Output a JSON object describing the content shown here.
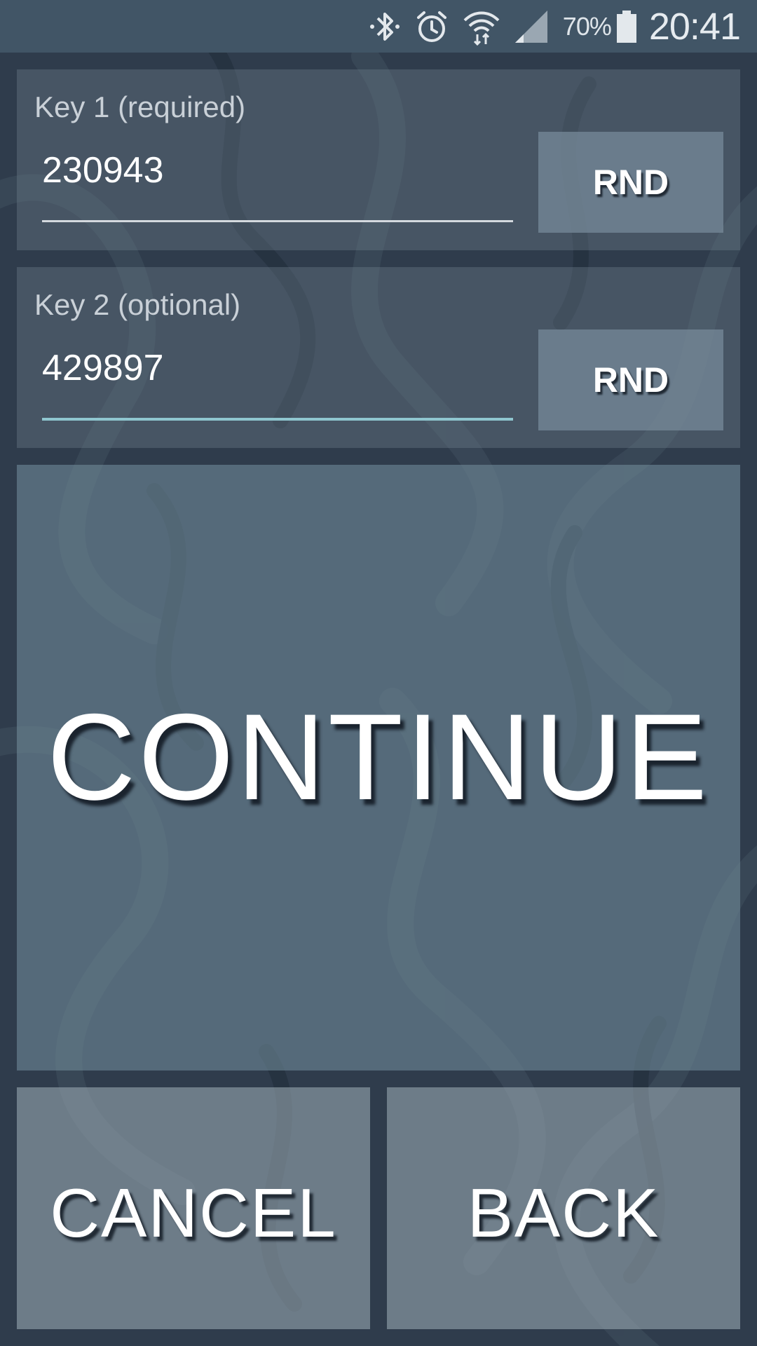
{
  "status_bar": {
    "icons": [
      "bluetooth-icon",
      "alarm-icon",
      "wifi-icon",
      "signal-icon",
      "battery-icon"
    ],
    "battery_percent": "70%",
    "time": "20:41"
  },
  "key1": {
    "label": "Key 1 (required)",
    "value": "230943",
    "button_label": "RND"
  },
  "key2": {
    "label": "Key 2 (optional)",
    "value": "429897",
    "button_label": "RND"
  },
  "actions": {
    "continue_label": "CONTINUE",
    "cancel_label": "CANCEL",
    "back_label": "BACK"
  },
  "colors": {
    "status_bar": "#415566",
    "background": "#2d3a4a",
    "focused_underline": "#8fc6cf"
  }
}
